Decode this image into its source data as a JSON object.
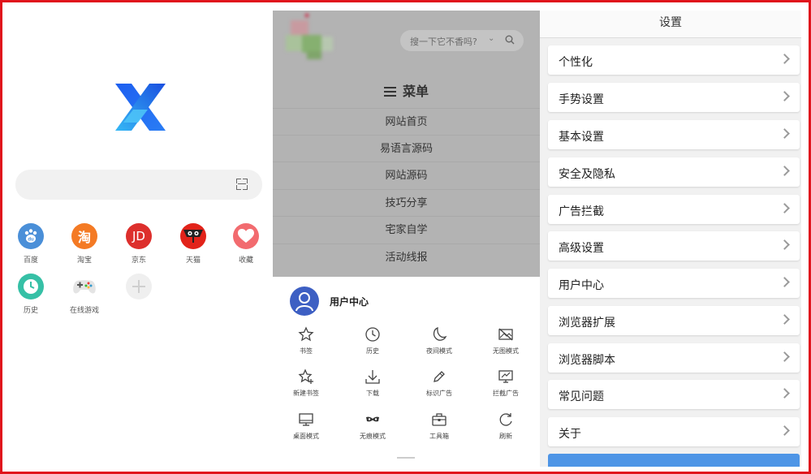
{
  "left": {
    "shortcuts": [
      {
        "label": "百度",
        "icon": "du",
        "color": "#4a8fd8"
      },
      {
        "label": "淘宝",
        "icon": "淘",
        "color": "#f47a24"
      },
      {
        "label": "京东",
        "icon": "JD",
        "color": "#dd2f2c"
      },
      {
        "label": "天猫",
        "icon": "cat",
        "color": "#e2231a"
      },
      {
        "label": "收藏",
        "icon": "heart",
        "color": "#f26b6f"
      },
      {
        "label": "历史",
        "icon": "clock",
        "color": "#36c0a6"
      },
      {
        "label": "在线游戏",
        "icon": "gamepad",
        "color": "#e8e8e8"
      },
      {
        "label": "",
        "icon": "plus",
        "color": "#eeeeee"
      }
    ]
  },
  "middle": {
    "search_placeholder": "搜一下它不香吗?",
    "menu_title": "菜单",
    "menu_items": [
      "网站首页",
      "易语言源码",
      "网站源码",
      "技巧分享",
      "宅家自学",
      "活动线报"
    ],
    "user_center": "用户中心",
    "tools": [
      {
        "label": "书签",
        "icon": "star-icon"
      },
      {
        "label": "历史",
        "icon": "clock-icon"
      },
      {
        "label": "夜间模式",
        "icon": "moon-icon"
      },
      {
        "label": "无图模式",
        "icon": "no-image-icon"
      },
      {
        "label": "新建书签",
        "icon": "star-plus-icon"
      },
      {
        "label": "下载",
        "icon": "download-icon"
      },
      {
        "label": "标识广告",
        "icon": "pen-icon"
      },
      {
        "label": "拦截广告",
        "icon": "block-ad-icon"
      },
      {
        "label": "桌面模式",
        "icon": "monitor-icon"
      },
      {
        "label": "无痕模式",
        "icon": "mask-icon"
      },
      {
        "label": "工具箱",
        "icon": "toolbox-icon"
      },
      {
        "label": "刷新",
        "icon": "refresh-icon"
      }
    ]
  },
  "right": {
    "title": "设置",
    "items": [
      "个性化",
      "手势设置",
      "基本设置",
      "安全及隐私",
      "广告拦截",
      "高级设置",
      "用户中心",
      "浏览器扩展",
      "浏览器脚本",
      "常见问题",
      "关于"
    ]
  }
}
